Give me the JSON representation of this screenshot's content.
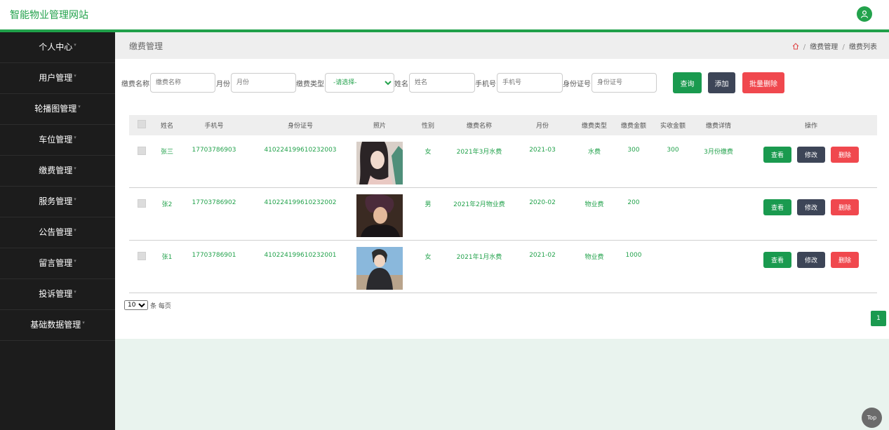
{
  "app": {
    "title": "智能物业管理网站"
  },
  "sidebar": {
    "items": [
      {
        "label": "个人中心"
      },
      {
        "label": "用户管理"
      },
      {
        "label": "轮播图管理"
      },
      {
        "label": "车位管理"
      },
      {
        "label": "缴费管理"
      },
      {
        "label": "服务管理"
      },
      {
        "label": "公告管理"
      },
      {
        "label": "留言管理"
      },
      {
        "label": "投诉管理"
      },
      {
        "label": "基础数据管理"
      }
    ]
  },
  "page": {
    "title": "缴费管理"
  },
  "breadcrumb": {
    "items": [
      "缴费管理",
      "缴费列表"
    ],
    "separator": "/"
  },
  "filter": {
    "fee_name_label": "缴费名称",
    "fee_name_placeholder": "缴费名称",
    "month_label": "月份",
    "month_placeholder": "月份",
    "fee_type_label": "缴费类型",
    "fee_type_selected": "-请选择-",
    "name_label": "姓名",
    "name_placeholder": "姓名",
    "phone_label": "手机号",
    "phone_placeholder": "手机号",
    "id_label": "身份证号",
    "id_placeholder": "身份证号",
    "query_button": "查询",
    "add_button": "添加",
    "batch_delete_button": "批量删除"
  },
  "table": {
    "headers": [
      "姓名",
      "手机号",
      "身份证号",
      "照片",
      "性别",
      "缴费名称",
      "月份",
      "缴费类型",
      "缴费金额",
      "实收金额",
      "缴费详情",
      "操作"
    ],
    "rows": [
      {
        "name": "张三",
        "phone": "17703786903",
        "id": "410224199610232003",
        "gender": "女",
        "fee_name": "2021年3月水费",
        "month": "2021-03",
        "fee_type": "水费",
        "amount": "300",
        "received": "300",
        "detail": "3月份缴费"
      },
      {
        "name": "张2",
        "phone": "17703786902",
        "id": "410224199610232002",
        "gender": "男",
        "fee_name": "2021年2月物业费",
        "month": "2020-02",
        "fee_type": "物业费",
        "amount": "200",
        "received": "",
        "detail": ""
      },
      {
        "name": "张1",
        "phone": "17703786901",
        "id": "410224199610232001",
        "gender": "女",
        "fee_name": "2021年1月水费",
        "month": "2021-02",
        "fee_type": "物业费",
        "amount": "1000",
        "received": "",
        "detail": ""
      }
    ],
    "actions": {
      "view": "查看",
      "edit": "修改",
      "delete": "删除"
    }
  },
  "pagination": {
    "page_size": "10",
    "per_page_label": "条 每页",
    "current_page": "1"
  },
  "scroll_top": {
    "label": "Top"
  },
  "colors": {
    "accent": "#23a24c",
    "sidebar_bg": "#1c1c1c",
    "danger": "#f0484e",
    "dark": "#3d4557"
  }
}
